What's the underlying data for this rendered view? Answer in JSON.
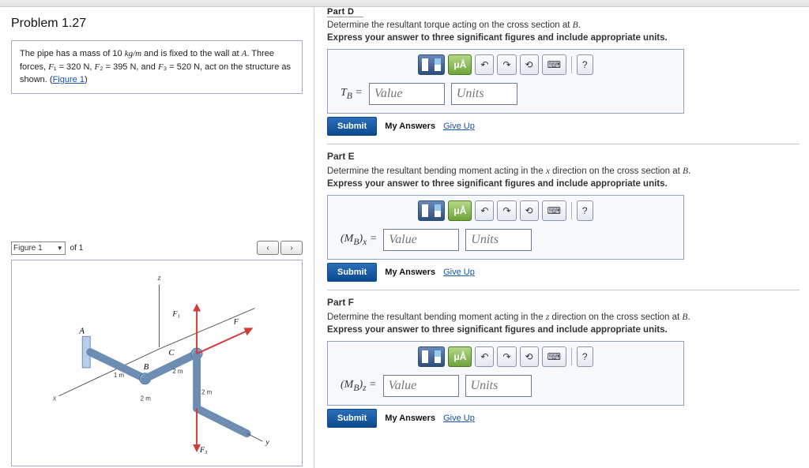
{
  "problem": {
    "title": "Problem 1.27",
    "description_html": "The pipe has a mass of 10 kg/m and is fixed to the wall at A. Three forces, F₁ = 320 N, F₂ = 395 N, and F₃ = 520 N, act on the structure as shown.",
    "figure_link": "Figure 1"
  },
  "figure_nav": {
    "select_label": "Figure 1",
    "of_text": "of 1"
  },
  "partD": {
    "cut_label": "Part D",
    "prompt": "Determine the resultant torque acting on the cross section at B.",
    "directions": "Express your answer to three significant figures and include appropriate units.",
    "var_label": "T_B =",
    "value_placeholder": "Value",
    "units_placeholder": "Units"
  },
  "partE": {
    "label": "Part E",
    "prompt": "Determine the resultant bending moment acting in the x direction on the cross section at B.",
    "directions": "Express your answer to three significant figures and include appropriate units.",
    "var_label": "(M_B)_x =",
    "value_placeholder": "Value",
    "units_placeholder": "Units"
  },
  "partF": {
    "label": "Part F",
    "prompt": "Determine the resultant bending moment acting in the z direction on the cross section at B.",
    "directions": "Express your answer to three significant figures and include appropriate units.",
    "var_label": "(M_B)_z =",
    "value_placeholder": "Value",
    "units_placeholder": "Units"
  },
  "toolbar": {
    "ua_label": "μÅ",
    "help": "?"
  },
  "actions": {
    "submit": "Submit",
    "my_answers": "My Answers",
    "give_up": "Give Up"
  }
}
